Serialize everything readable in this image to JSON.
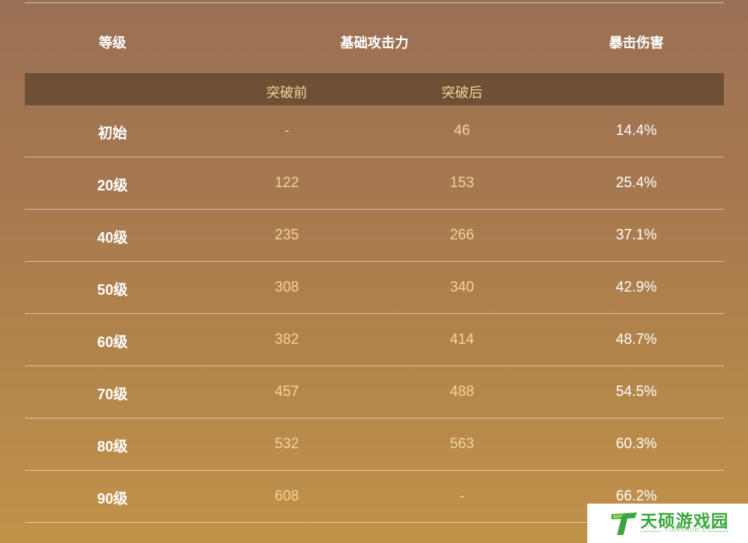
{
  "table": {
    "headers": {
      "level": "等级",
      "base_atk": "基础攻击力",
      "crit_dmg": "暴击伤害"
    },
    "subheaders": {
      "before": "突破前",
      "after": "突破后"
    },
    "rows": [
      {
        "level": "初始",
        "before": "-",
        "after": "46",
        "crit": "14.4%"
      },
      {
        "level": "20级",
        "before": "122",
        "after": "153",
        "crit": "25.4%"
      },
      {
        "level": "40级",
        "before": "235",
        "after": "266",
        "crit": "37.1%"
      },
      {
        "level": "50级",
        "before": "308",
        "after": "340",
        "crit": "42.9%"
      },
      {
        "level": "60级",
        "before": "382",
        "after": "414",
        "crit": "48.7%"
      },
      {
        "level": "70级",
        "before": "457",
        "after": "488",
        "crit": "54.5%"
      },
      {
        "level": "80级",
        "before": "532",
        "after": "563",
        "crit": "60.3%"
      },
      {
        "level": "90级",
        "before": "608",
        "after": "-",
        "crit": "66.2%"
      }
    ]
  },
  "watermark": {
    "name": "天硕游戏园",
    "sub": "TIANSHUO.CC",
    "brand_color": "#3aa63c"
  }
}
